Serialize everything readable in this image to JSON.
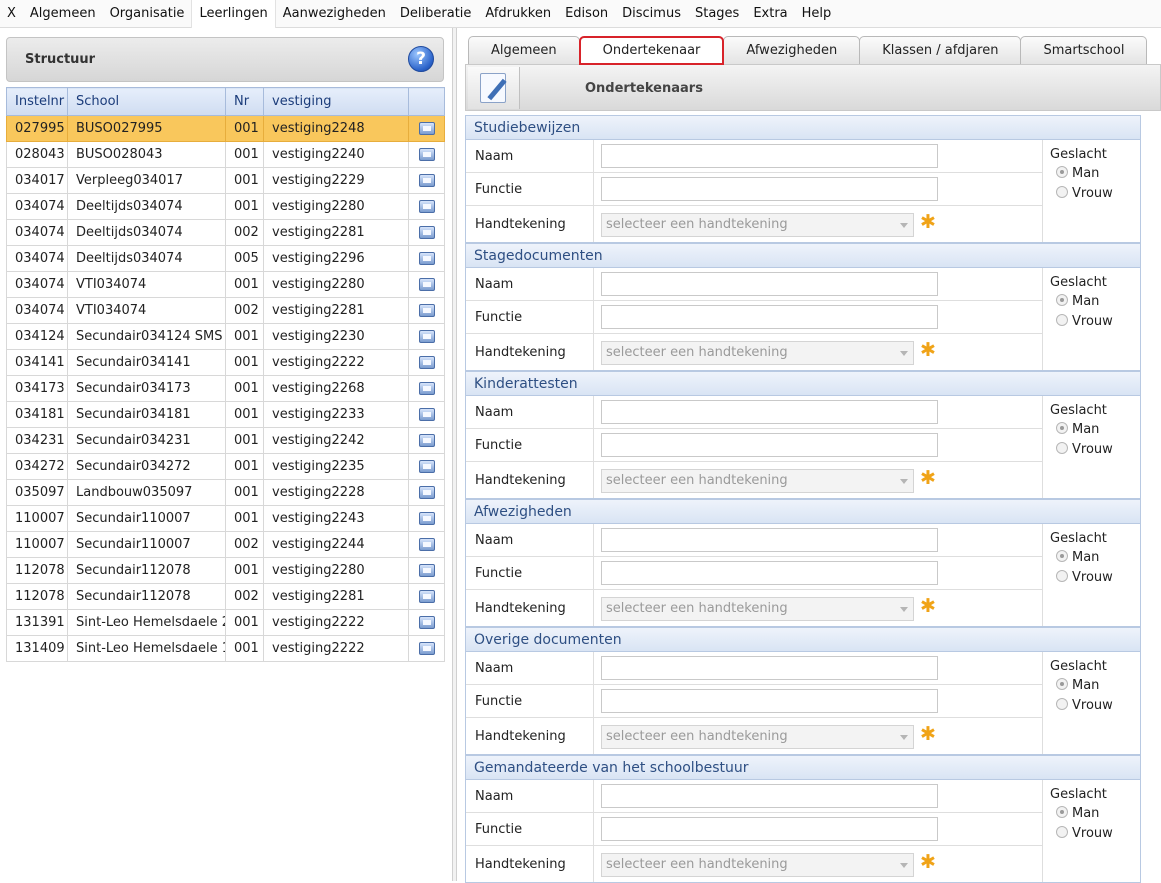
{
  "menu": [
    "X",
    "Algemeen",
    "Organisatie",
    "Leerlingen",
    "Aanwezigheden",
    "Deliberatie",
    "Afdrukken",
    "Edison",
    "Discimus",
    "Stages",
    "Extra",
    "Help"
  ],
  "structuur": {
    "title": "Structuur",
    "help_icon": "help-icon",
    "columns": [
      "Instelnr",
      "School",
      "Nr",
      "vestiging"
    ],
    "rows": [
      {
        "instelnr": "027995",
        "school": "BUSO027995",
        "nr": "001",
        "vestiging": "vestiging2248"
      },
      {
        "instelnr": "028043",
        "school": "BUSO028043",
        "nr": "001",
        "vestiging": "vestiging2240"
      },
      {
        "instelnr": "034017",
        "school": "Verpleeg034017",
        "nr": "001",
        "vestiging": "vestiging2229"
      },
      {
        "instelnr": "034074",
        "school": "Deeltijds034074",
        "nr": "001",
        "vestiging": "vestiging2280"
      },
      {
        "instelnr": "034074",
        "school": "Deeltijds034074",
        "nr": "002",
        "vestiging": "vestiging2281"
      },
      {
        "instelnr": "034074",
        "school": "Deeltijds034074",
        "nr": "005",
        "vestiging": "vestiging2296"
      },
      {
        "instelnr": "034074",
        "school": "VTI034074",
        "nr": "001",
        "vestiging": "vestiging2280"
      },
      {
        "instelnr": "034074",
        "school": "VTI034074",
        "nr": "002",
        "vestiging": "vestiging2281"
      },
      {
        "instelnr": "034124",
        "school": "Secundair034124 SMS",
        "nr": "001",
        "vestiging": "vestiging2230"
      },
      {
        "instelnr": "034141",
        "school": "Secundair034141",
        "nr": "001",
        "vestiging": "vestiging2222"
      },
      {
        "instelnr": "034173",
        "school": "Secundair034173",
        "nr": "001",
        "vestiging": "vestiging2268"
      },
      {
        "instelnr": "034181",
        "school": "Secundair034181",
        "nr": "001",
        "vestiging": "vestiging2233"
      },
      {
        "instelnr": "034231",
        "school": "Secundair034231",
        "nr": "001",
        "vestiging": "vestiging2242"
      },
      {
        "instelnr": "034272",
        "school": "Secundair034272",
        "nr": "001",
        "vestiging": "vestiging2235"
      },
      {
        "instelnr": "035097",
        "school": "Landbouw035097",
        "nr": "001",
        "vestiging": "vestiging2228"
      },
      {
        "instelnr": "110007",
        "school": "Secundair110007",
        "nr": "001",
        "vestiging": "vestiging2243"
      },
      {
        "instelnr": "110007",
        "school": "Secundair110007",
        "nr": "002",
        "vestiging": "vestiging2244"
      },
      {
        "instelnr": "112078",
        "school": "Secundair112078",
        "nr": "001",
        "vestiging": "vestiging2280"
      },
      {
        "instelnr": "112078",
        "school": "Secundair112078",
        "nr": "002",
        "vestiging": "vestiging2281"
      },
      {
        "instelnr": "131391",
        "school": "Sint-Leo Hemelsdaele 2",
        "nr": "001",
        "vestiging": "vestiging2222"
      },
      {
        "instelnr": "131409",
        "school": "Sint-Leo Hemelsdaele 1",
        "nr": "001",
        "vestiging": "vestiging2222"
      }
    ],
    "selected_row": 0,
    "selected_color": "#f9c75c"
  },
  "tabs": [
    "Algemeen",
    "Ondertekenaar",
    "Afwezigheden",
    "Klassen / afdjaren",
    "Smartschool"
  ],
  "active_tab": 1,
  "panel": {
    "title": "Ondertekenaars",
    "icon": "pencil-icon"
  },
  "form_labels": {
    "naam": "Naam",
    "functie": "Functie",
    "handtekening": "Handtekening",
    "select_placeholder": "selecteer een handtekening",
    "geslacht": "Geslacht",
    "man": "Man",
    "vrouw": "Vrouw"
  },
  "sections": [
    {
      "title": "Studiebewijzen"
    },
    {
      "title": "Stagedocumenten"
    },
    {
      "title": "Kinderattesten"
    },
    {
      "title": "Afwezigheden"
    },
    {
      "title": "Overige documenten"
    },
    {
      "title": "Gemandateerde van het schoolbestuur"
    }
  ],
  "colors": {
    "active_tab_border": "#d8232a",
    "asterisk": "#f0a317",
    "section_title": "#2e4f83"
  }
}
